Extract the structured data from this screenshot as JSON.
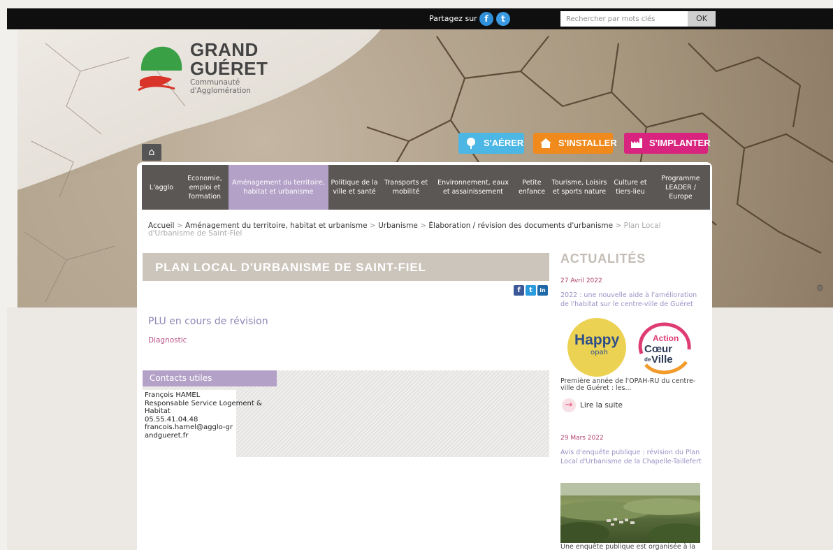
{
  "topbar": {
    "share_label": "Partagez sur",
    "facebook_glyph": "f",
    "twitter_glyph": "t",
    "search_placeholder": "Rechercher par mots clés",
    "search_button": "OK"
  },
  "logo": {
    "line1": "GRAND",
    "line2": "GUÉRET",
    "line3": "Communauté",
    "line4": "d'Agglomération",
    "colors": {
      "green": "#3aa046",
      "red": "#d8342a"
    }
  },
  "hero": {
    "home_icon": "⌂",
    "buttons": [
      {
        "label": "S'AÉRER",
        "color": "#4cb6e4",
        "icon": "tree-icon"
      },
      {
        "label": "S'INSTALLER",
        "color": "#f08a1c",
        "icon": "house-icon"
      },
      {
        "label": "S'IMPLANTER",
        "color": "#d9247f",
        "icon": "factory-icon"
      }
    ]
  },
  "nav": {
    "items": [
      {
        "label": "L'agglo",
        "active": false
      },
      {
        "label": "Economie, emploi et formation",
        "active": false
      },
      {
        "label": "Aménagement du territoire, habitat et urbanisme",
        "active": true
      },
      {
        "label": "Politique de la ville et santé",
        "active": false
      },
      {
        "label": "Transports et mobilité",
        "active": false
      },
      {
        "label": "Environnement, eaux et assainissement",
        "active": false
      },
      {
        "label": "Petite enfance",
        "active": false
      },
      {
        "label": "Tourisme, Loisirs et sports nature",
        "active": false
      },
      {
        "label": "Culture et tiers-lieu",
        "active": false
      },
      {
        "label": "Programme LEADER / Europe",
        "active": false
      }
    ]
  },
  "breadcrumb": {
    "items": [
      "Accueil",
      "Aménagement du territoire, habitat et urbanisme",
      "Urbanisme",
      "Élaboration / révision des documents d'urbanisme"
    ],
    "separator": ">",
    "current": "Plan Local d'Urbanisme de Saint-Fiel"
  },
  "main": {
    "title": "PLAN LOCAL D'URBANISME DE SAINT-FIEL",
    "share": {
      "facebook": "f",
      "twitter": "t",
      "linkedin": "in"
    },
    "section_heading": "PLU en cours de révision",
    "link": "Diagnostic",
    "contacts": {
      "heading": "Contacts utiles",
      "name": "François HAMEL",
      "role": "Responsable Service Logement & Habitat",
      "phone": "05.55.41.04.48",
      "email": "francois.hamel@agglo-grandgueret.fr"
    }
  },
  "sidebar": {
    "title": "ACTUALITÉS",
    "news": [
      {
        "date": "27 Avril 2022",
        "title": "2022 : une nouvelle aide à l'amélioration de l'habitat sur le centre-ville de Guéret",
        "happy_label": "Happy",
        "happy_sub": "opah",
        "acv_line1": "Action",
        "acv_line2": "Cœur",
        "acv_line3": "de",
        "acv_line4": "Ville",
        "desc": "Première année de l'OPAH-RU du centre-ville de Guéret : les...",
        "more": "Lire la suite",
        "more_icon": "→"
      },
      {
        "date": "29 Mars 2022",
        "title": "Avis d'enquête publique : révision du Plan Local d'Urbanisme de la Chapelle-Taillefert",
        "desc": "Une enquête publique est organisée à la"
      }
    ]
  },
  "scroll_icon": "⊚"
}
